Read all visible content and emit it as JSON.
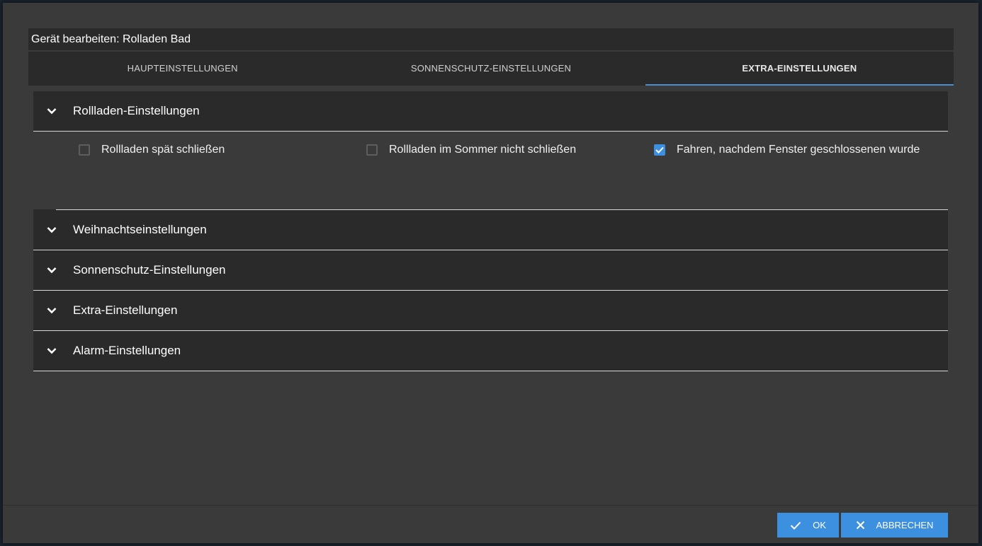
{
  "dialog": {
    "title": "Gerät bearbeiten: Rolladen Bad"
  },
  "tabs": [
    {
      "label": "HAUPTEINSTELLUNGEN",
      "active": false
    },
    {
      "label": "SONNENSCHUTZ-EINSTELLUNGEN",
      "active": false
    },
    {
      "label": "EXTRA-EINSTELLUNGEN",
      "active": true
    }
  ],
  "accordion": {
    "sections": [
      {
        "label": "Rollladen-Einstellungen",
        "expanded": true,
        "icon": "chevron-down-icon"
      },
      {
        "label": "Weihnachtseinstellungen",
        "expanded": false,
        "icon": "chevron-down-icon"
      },
      {
        "label": "Sonnenschutz-Einstellungen",
        "expanded": false,
        "icon": "chevron-down-icon"
      },
      {
        "label": "Extra-Einstellungen",
        "expanded": false,
        "icon": "chevron-down-icon"
      },
      {
        "label": "Alarm-Einstellungen",
        "expanded": false,
        "icon": "chevron-down-icon"
      }
    ],
    "rollladen_options": [
      {
        "label": "Rollladen spät schließen",
        "checked": false
      },
      {
        "label": "Rollladen im Sommer nicht schließen",
        "checked": false
      },
      {
        "label": "Fahren, nachdem Fenster geschlossenen wurde",
        "checked": true
      }
    ]
  },
  "footer": {
    "ok_label": "OK",
    "cancel_label": "ABBRECHEN"
  },
  "colors": {
    "accent": "#3d8fe0",
    "dialog_bg": "#3a3a3a",
    "panel_bg": "#2a2a2a"
  }
}
